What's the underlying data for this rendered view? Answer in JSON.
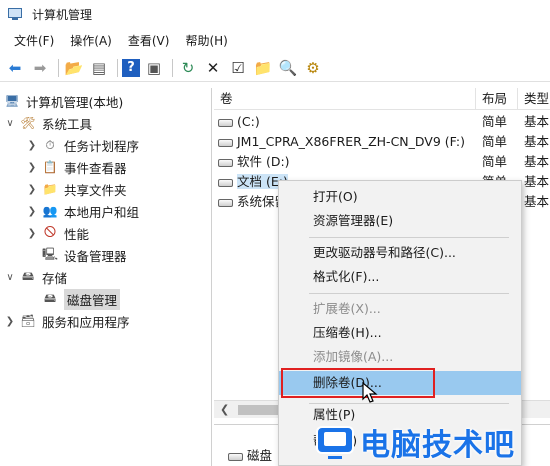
{
  "window": {
    "title": "计算机管理"
  },
  "menubar": [
    {
      "label": "文件(F)"
    },
    {
      "label": "操作(A)"
    },
    {
      "label": "查看(V)"
    },
    {
      "label": "帮助(H)"
    }
  ],
  "tree": {
    "root": "计算机管理(本地)",
    "items": [
      {
        "label": "系统工具"
      },
      {
        "label": "任务计划程序"
      },
      {
        "label": "事件查看器"
      },
      {
        "label": "共享文件夹"
      },
      {
        "label": "本地用户和组"
      },
      {
        "label": "性能"
      },
      {
        "label": "设备管理器"
      },
      {
        "label": "存储"
      },
      {
        "label": "磁盘管理"
      },
      {
        "label": "服务和应用程序"
      }
    ]
  },
  "volumes": {
    "columns": [
      "卷",
      "布局",
      "类型"
    ],
    "rows": [
      {
        "name": "(C:)",
        "layout": "简单",
        "type": "基本"
      },
      {
        "name": "JM1_CPRA_X86FRER_ZH-CN_DV9 (F:)",
        "layout": "简单",
        "type": "基本"
      },
      {
        "name": "软件 (D:)",
        "layout": "简单",
        "type": "基本"
      },
      {
        "name": "文档 (E:)",
        "layout": "简单",
        "type": "基本"
      },
      {
        "name": "系统保留",
        "layout": "简单",
        "type": "基本"
      }
    ]
  },
  "context_menu": {
    "items": [
      {
        "label": "打开(O)"
      },
      {
        "label": "资源管理器(E)"
      },
      {
        "label": "更改驱动器号和路径(C)..."
      },
      {
        "label": "格式化(F)..."
      },
      {
        "label": "扩展卷(X)..."
      },
      {
        "label": "压缩卷(H)..."
      },
      {
        "label": "添加镜像(A)..."
      },
      {
        "label": "删除卷(D)..."
      },
      {
        "label": "属性(P)"
      },
      {
        "label": "帮助(H)"
      }
    ]
  },
  "disk_pane": {
    "label": "磁盘"
  },
  "watermark": {
    "text": "电脑技术吧"
  },
  "colors": {
    "accent": "#1a73e8",
    "highlight": "#99c9ef",
    "callout": "#e02020"
  }
}
